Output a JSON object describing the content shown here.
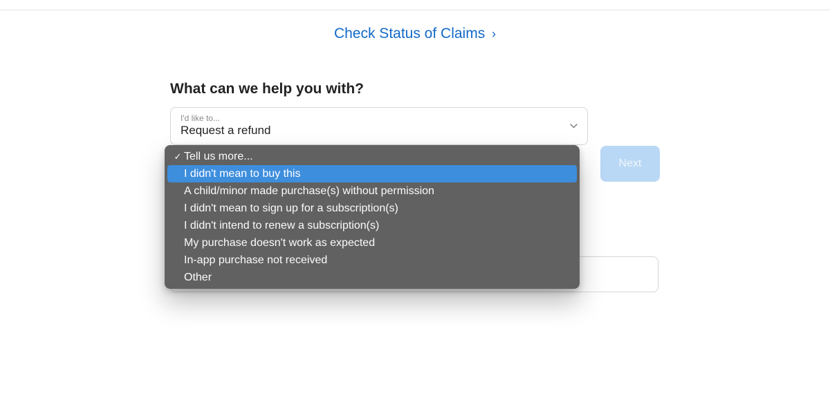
{
  "header": {
    "link_text": "Check Status of Claims",
    "link_chevron": "›"
  },
  "form": {
    "heading": "What can we help you with?",
    "first_select": {
      "label": "I'd like to...",
      "value": "Request a refund"
    },
    "next_button": "Next"
  },
  "dropdown": {
    "placeholder_option": "Tell us more...",
    "options": [
      "I didn't mean to buy this",
      "A child/minor made purchase(s) without permission",
      "I didn't mean to sign up for a subscription(s)",
      "I didn't intend to renew a subscription(s)",
      "My purchase doesn't work as expected",
      "In-app purchase not received",
      "Other"
    ],
    "highlighted_index": 0,
    "selected_is_placeholder": true
  }
}
